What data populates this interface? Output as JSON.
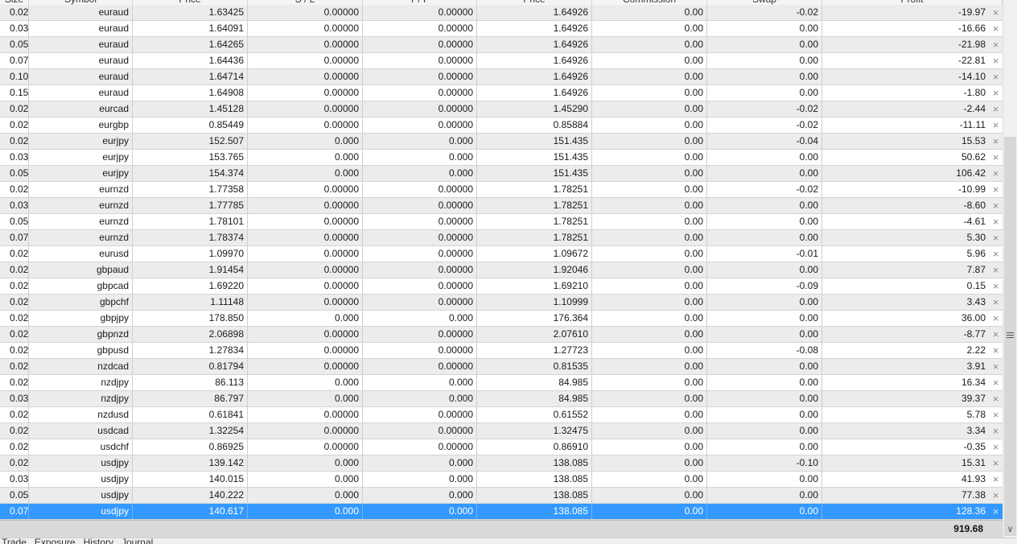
{
  "table": {
    "columns": [
      "Size",
      "Symbol",
      "Price",
      "S / L",
      "T / P",
      "Price",
      "Commission",
      "Swap",
      "Profit"
    ],
    "rows": [
      [
        "0.02",
        "euraud",
        "1.63425",
        "0.00000",
        "0.00000",
        "1.64926",
        "0.00",
        "-0.02",
        "-19.97"
      ],
      [
        "0.03",
        "euraud",
        "1.64091",
        "0.00000",
        "0.00000",
        "1.64926",
        "0.00",
        "0.00",
        "-16.66"
      ],
      [
        "0.05",
        "euraud",
        "1.64265",
        "0.00000",
        "0.00000",
        "1.64926",
        "0.00",
        "0.00",
        "-21.98"
      ],
      [
        "0.07",
        "euraud",
        "1.64436",
        "0.00000",
        "0.00000",
        "1.64926",
        "0.00",
        "0.00",
        "-22.81"
      ],
      [
        "0.10",
        "euraud",
        "1.64714",
        "0.00000",
        "0.00000",
        "1.64926",
        "0.00",
        "0.00",
        "-14.10"
      ],
      [
        "0.15",
        "euraud",
        "1.64908",
        "0.00000",
        "0.00000",
        "1.64926",
        "0.00",
        "0.00",
        "-1.80"
      ],
      [
        "0.02",
        "eurcad",
        "1.45128",
        "0.00000",
        "0.00000",
        "1.45290",
        "0.00",
        "-0.02",
        "-2.44"
      ],
      [
        "0.02",
        "eurgbp",
        "0.85449",
        "0.00000",
        "0.00000",
        "0.85884",
        "0.00",
        "-0.02",
        "-11.11"
      ],
      [
        "0.02",
        "eurjpy",
        "152.507",
        "0.000",
        "0.000",
        "151.435",
        "0.00",
        "-0.04",
        "15.53"
      ],
      [
        "0.03",
        "eurjpy",
        "153.765",
        "0.000",
        "0.000",
        "151.435",
        "0.00",
        "0.00",
        "50.62"
      ],
      [
        "0.05",
        "eurjpy",
        "154.374",
        "0.000",
        "0.000",
        "151.435",
        "0.00",
        "0.00",
        "106.42"
      ],
      [
        "0.02",
        "eurnzd",
        "1.77358",
        "0.00000",
        "0.00000",
        "1.78251",
        "0.00",
        "-0.02",
        "-10.99"
      ],
      [
        "0.03",
        "eurnzd",
        "1.77785",
        "0.00000",
        "0.00000",
        "1.78251",
        "0.00",
        "0.00",
        "-8.60"
      ],
      [
        "0.05",
        "eurnzd",
        "1.78101",
        "0.00000",
        "0.00000",
        "1.78251",
        "0.00",
        "0.00",
        "-4.61"
      ],
      [
        "0.07",
        "eurnzd",
        "1.78374",
        "0.00000",
        "0.00000",
        "1.78251",
        "0.00",
        "0.00",
        "5.30"
      ],
      [
        "0.02",
        "eurusd",
        "1.09970",
        "0.00000",
        "0.00000",
        "1.09672",
        "0.00",
        "-0.01",
        "5.96"
      ],
      [
        "0.02",
        "gbpaud",
        "1.91454",
        "0.00000",
        "0.00000",
        "1.92046",
        "0.00",
        "0.00",
        "7.87"
      ],
      [
        "0.02",
        "gbpcad",
        "1.69220",
        "0.00000",
        "0.00000",
        "1.69210",
        "0.00",
        "-0.09",
        "0.15"
      ],
      [
        "0.02",
        "gbpchf",
        "1.11148",
        "0.00000",
        "0.00000",
        "1.10999",
        "0.00",
        "0.00",
        "3.43"
      ],
      [
        "0.02",
        "gbpjpy",
        "178.850",
        "0.000",
        "0.000",
        "176.364",
        "0.00",
        "0.00",
        "36.00"
      ],
      [
        "0.02",
        "gbpnzd",
        "2.06898",
        "0.00000",
        "0.00000",
        "2.07610",
        "0.00",
        "0.00",
        "-8.77"
      ],
      [
        "0.02",
        "gbpusd",
        "1.27834",
        "0.00000",
        "0.00000",
        "1.27723",
        "0.00",
        "-0.08",
        "2.22"
      ],
      [
        "0.02",
        "nzdcad",
        "0.81794",
        "0.00000",
        "0.00000",
        "0.81535",
        "0.00",
        "0.00",
        "3.91"
      ],
      [
        "0.02",
        "nzdjpy",
        "86.113",
        "0.000",
        "0.000",
        "84.985",
        "0.00",
        "0.00",
        "16.34"
      ],
      [
        "0.03",
        "nzdjpy",
        "86.797",
        "0.000",
        "0.000",
        "84.985",
        "0.00",
        "0.00",
        "39.37"
      ],
      [
        "0.02",
        "nzdusd",
        "0.61841",
        "0.00000",
        "0.00000",
        "0.61552",
        "0.00",
        "0.00",
        "5.78"
      ],
      [
        "0.02",
        "usdcad",
        "1.32254",
        "0.00000",
        "0.00000",
        "1.32475",
        "0.00",
        "0.00",
        "3.34"
      ],
      [
        "0.02",
        "usdchf",
        "0.86925",
        "0.00000",
        "0.00000",
        "0.86910",
        "0.00",
        "0.00",
        "-0.35"
      ],
      [
        "0.02",
        "usdjpy",
        "139.142",
        "0.000",
        "0.000",
        "138.085",
        "0.00",
        "-0.10",
        "15.31"
      ],
      [
        "0.03",
        "usdjpy",
        "140.015",
        "0.000",
        "0.000",
        "138.085",
        "0.00",
        "0.00",
        "41.93"
      ],
      [
        "0.05",
        "usdjpy",
        "140.222",
        "0.000",
        "0.000",
        "138.085",
        "0.00",
        "0.00",
        "77.38"
      ],
      [
        "0.07",
        "usdjpy",
        "140.617",
        "0.000",
        "0.000",
        "138.085",
        "0.00",
        "0.00",
        "128.36"
      ]
    ],
    "selected_row": 31,
    "close_icon": "×",
    "total_profit": "919.68"
  },
  "scrollbar": {
    "grip_icon": "≡",
    "down_icon": "∨"
  },
  "bottom_tabs": [
    "Trade",
    "Exposure",
    "History",
    "Journal"
  ],
  "colors": {
    "selection": "#3399ff",
    "alt_row": "#ececec",
    "total_bar": "#d9d9d9"
  }
}
